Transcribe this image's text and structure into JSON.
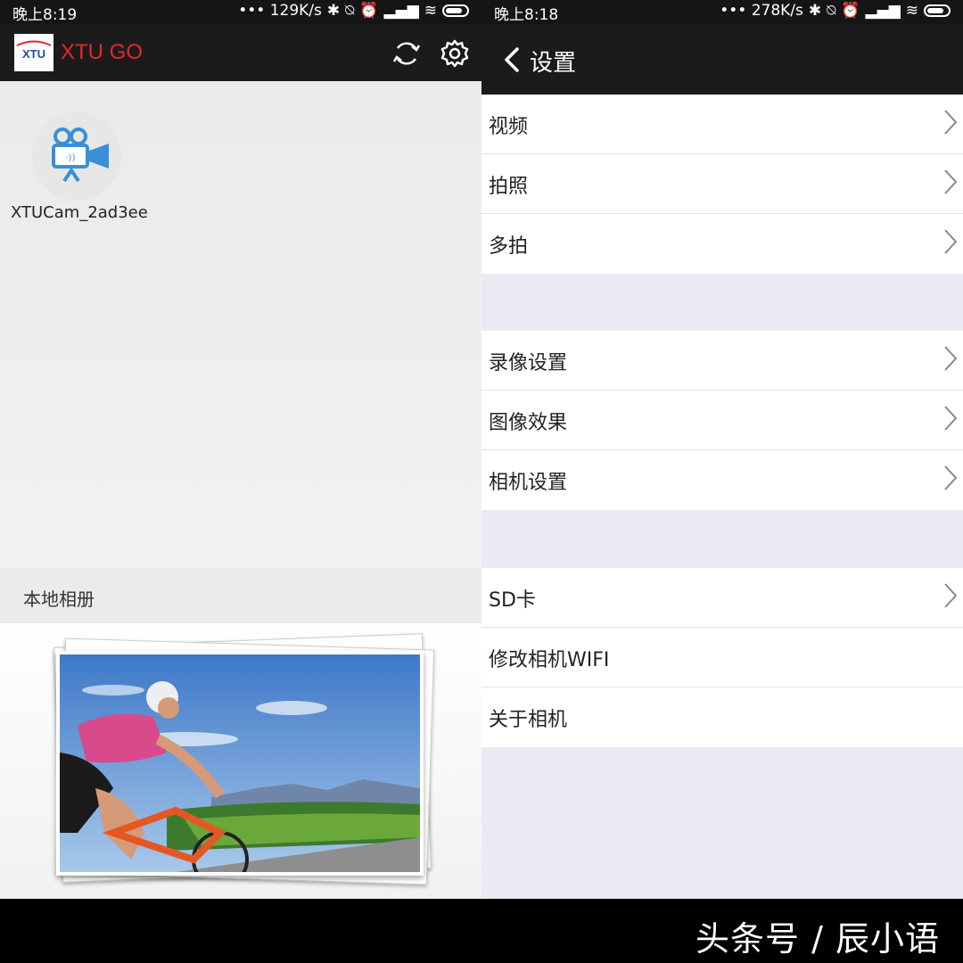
{
  "left": {
    "status": {
      "time": "晚上8:19",
      "signal_text": "••• 129K/s",
      "icons": [
        "bluetooth-icon",
        "mute-icon",
        "alarm-icon",
        "hd-signal-icon",
        "signal-icon",
        "wifi-icon",
        "battery-icon"
      ]
    },
    "appbar": {
      "logo_text": "XTU",
      "title": "XTU GO",
      "icons": [
        "refresh-icon",
        "gear-icon"
      ]
    },
    "device": {
      "name": "XTUCam_2ad3ee",
      "icon": "camera-icon"
    },
    "album": {
      "title": "本地相册"
    }
  },
  "right": {
    "status": {
      "time": "晚上8:18",
      "signal_text": "••• 278K/s",
      "icons": [
        "bluetooth-icon",
        "mute-icon",
        "alarm-icon",
        "hd-signal-icon",
        "signal-icon",
        "wifi-icon",
        "battery-icon"
      ]
    },
    "navbar": {
      "title": "设置",
      "back_icon": "back-icon"
    },
    "groups": [
      {
        "items": [
          {
            "label": "视频",
            "chevron": true
          },
          {
            "label": "拍照",
            "chevron": true
          },
          {
            "label": "多拍",
            "chevron": true
          }
        ]
      },
      {
        "items": [
          {
            "label": "录像设置",
            "chevron": true
          },
          {
            "label": "图像效果",
            "chevron": true
          },
          {
            "label": "相机设置",
            "chevron": true
          }
        ]
      },
      {
        "items": [
          {
            "label": "SD卡",
            "chevron": true
          },
          {
            "label": "修改相机WIFI",
            "chevron": false
          },
          {
            "label": "关于相机",
            "chevron": false
          }
        ]
      }
    ]
  },
  "watermark": "头条号 / 辰小语",
  "colors": {
    "brand_red": "#e8262d",
    "bar_dark": "#1b1b1b",
    "camera_blue": "#3a8fd8"
  }
}
